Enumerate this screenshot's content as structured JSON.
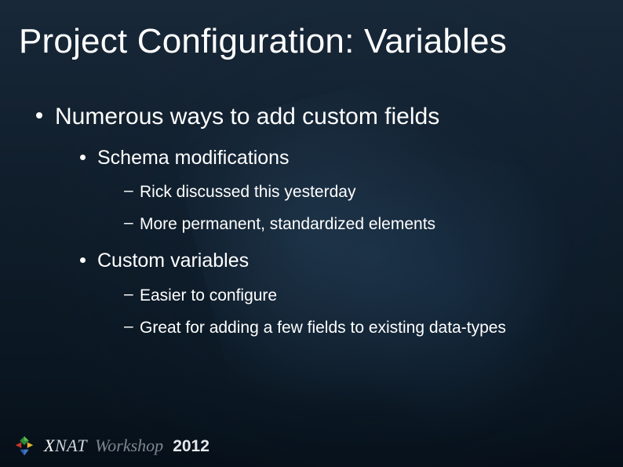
{
  "title": "Project Configuration: Variables",
  "bullets": {
    "l1_0": "Numerous ways to add custom fields",
    "l2_0": "Schema modifications",
    "l3_0": "Rick discussed this yesterday",
    "l3_1": "More permanent, standardized elements",
    "l2_1": "Custom variables",
    "l3_2": "Easier to configure",
    "l3_3": "Great for adding a few fields to existing data-types"
  },
  "footer": {
    "brand_prefix": "X",
    "brand_rest": "NAT",
    "workshop": "Workshop",
    "year": "2012"
  }
}
